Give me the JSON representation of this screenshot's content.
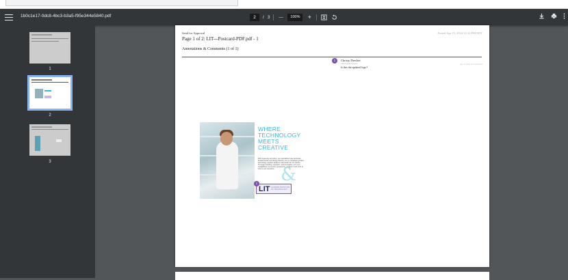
{
  "toolbar": {
    "filename": "1b0c1e17-0dc8-4bc3-b3a5-f95e344e5840.pdf",
    "current_page": "2",
    "page_sep": "/",
    "page_total": "3",
    "zoom_out": "—",
    "zoom": "100%",
    "zoom_in": "+"
  },
  "icons": [
    "menu-icon",
    "zoom-out-icon",
    "zoom-in-icon",
    "fit-page-icon",
    "rotate-icon",
    "download-icon",
    "print-icon",
    "more-icon"
  ],
  "sidebar": {
    "thumbnails": [
      {
        "label": "1"
      },
      {
        "label": "2",
        "selected": true
      },
      {
        "label": "3"
      }
    ]
  },
  "page": {
    "header_small": "Send for Approval",
    "title": "Page 1 of 2: LIT---Postcard-PDF.pdf - 1",
    "posted": "Posted Apr 15, 2024 12:12 PM EDT",
    "annotations_heading": "Annotations & Comments (1 of 1)",
    "comment": {
      "avatar": "1",
      "author": "Christy Drecker",
      "sub": "Christy@LIT.Group",
      "text": "Is this the updated logo?",
      "date": "Apr 15 2024 12:12:00 EDT"
    },
    "postcard": {
      "headline_1": "WHERE",
      "headline_2": "TECHNOLOGY",
      "headline_3": "MEETS",
      "headline_4": "CREATIVE",
      "body": "With ingenuity and drive, our specialists fuse technical fundamentals and design fluency, so our creatively guided technology pipeline delivers real results for our clients. Through branding, research, and innovation, LIT is an established community powered by creators of all sorts to inform and transform.",
      "logo_text": "LIT",
      "logo_sub": "LONDON INSTITUTE OF TECHNOLOGY",
      "marker": "1"
    }
  },
  "colors": {
    "toolbar_bg": "#323639",
    "viewer_bg": "#525659",
    "accent_selected": "#8ab4f8",
    "teal": "#3fb3d1",
    "purple": "#7a4fb0"
  }
}
